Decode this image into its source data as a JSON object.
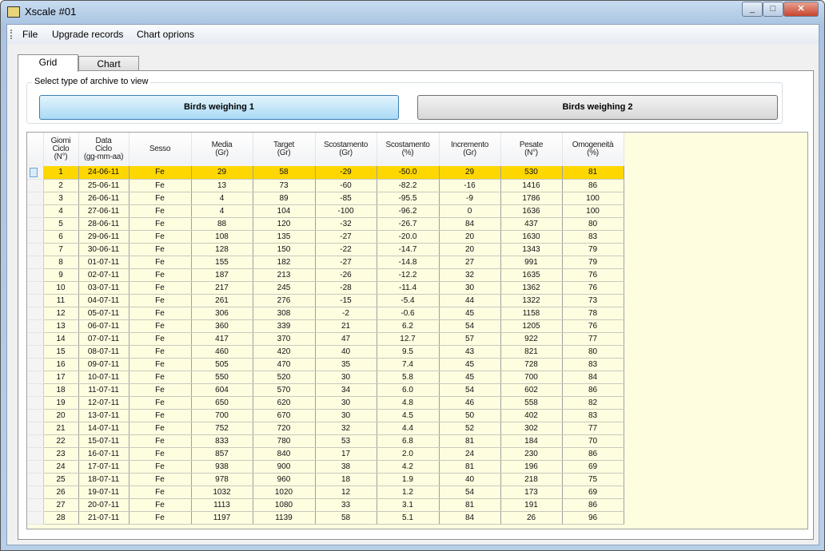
{
  "window": {
    "title": "Xscale #01",
    "controls": [
      "_",
      "□",
      "✕"
    ]
  },
  "menu": [
    "File",
    "Upgrade records",
    "Chart oprions"
  ],
  "tabs": [
    "Grid",
    "Chart"
  ],
  "archive": {
    "label": "Select type of archive to view",
    "buttons": [
      "Birds weighing 1",
      "Birds weighing 2"
    ]
  },
  "grid": {
    "headers": [
      "Giorni\nCiclo\n(N°)",
      "Data\nCiclo\n(gg-mm-aa)",
      "Sesso",
      "Media\n(Gr)",
      "Target\n(Gr)",
      "Scostamento\n(Gr)",
      "Scostamento\n(%)",
      "Incremento\n(Gr)",
      "Pesate\n(N°)",
      "Omogeneità\n(%)"
    ],
    "selected_row": 0,
    "rows": [
      [
        "1",
        "24-06-11",
        "Fe",
        "29",
        "58",
        "-29",
        "-50.0",
        "29",
        "530",
        "81"
      ],
      [
        "2",
        "25-06-11",
        "Fe",
        "13",
        "73",
        "-60",
        "-82.2",
        "-16",
        "1416",
        "86"
      ],
      [
        "3",
        "26-06-11",
        "Fe",
        "4",
        "89",
        "-85",
        "-95.5",
        "-9",
        "1786",
        "100"
      ],
      [
        "4",
        "27-06-11",
        "Fe",
        "4",
        "104",
        "-100",
        "-96.2",
        "0",
        "1636",
        "100"
      ],
      [
        "5",
        "28-06-11",
        "Fe",
        "88",
        "120",
        "-32",
        "-26.7",
        "84",
        "437",
        "80"
      ],
      [
        "6",
        "29-06-11",
        "Fe",
        "108",
        "135",
        "-27",
        "-20.0",
        "20",
        "1630",
        "83"
      ],
      [
        "7",
        "30-06-11",
        "Fe",
        "128",
        "150",
        "-22",
        "-14.7",
        "20",
        "1343",
        "79"
      ],
      [
        "8",
        "01-07-11",
        "Fe",
        "155",
        "182",
        "-27",
        "-14.8",
        "27",
        "991",
        "79"
      ],
      [
        "9",
        "02-07-11",
        "Fe",
        "187",
        "213",
        "-26",
        "-12.2",
        "32",
        "1635",
        "76"
      ],
      [
        "10",
        "03-07-11",
        "Fe",
        "217",
        "245",
        "-28",
        "-11.4",
        "30",
        "1362",
        "76"
      ],
      [
        "11",
        "04-07-11",
        "Fe",
        "261",
        "276",
        "-15",
        "-5.4",
        "44",
        "1322",
        "73"
      ],
      [
        "12",
        "05-07-11",
        "Fe",
        "306",
        "308",
        "-2",
        "-0.6",
        "45",
        "1158",
        "78"
      ],
      [
        "13",
        "06-07-11",
        "Fe",
        "360",
        "339",
        "21",
        "6.2",
        "54",
        "1205",
        "76"
      ],
      [
        "14",
        "07-07-11",
        "Fe",
        "417",
        "370",
        "47",
        "12.7",
        "57",
        "922",
        "77"
      ],
      [
        "15",
        "08-07-11",
        "Fe",
        "460",
        "420",
        "40",
        "9.5",
        "43",
        "821",
        "80"
      ],
      [
        "16",
        "09-07-11",
        "Fe",
        "505",
        "470",
        "35",
        "7.4",
        "45",
        "728",
        "83"
      ],
      [
        "17",
        "10-07-11",
        "Fe",
        "550",
        "520",
        "30",
        "5.8",
        "45",
        "700",
        "84"
      ],
      [
        "18",
        "11-07-11",
        "Fe",
        "604",
        "570",
        "34",
        "6.0",
        "54",
        "602",
        "86"
      ],
      [
        "19",
        "12-07-11",
        "Fe",
        "650",
        "620",
        "30",
        "4.8",
        "46",
        "558",
        "82"
      ],
      [
        "20",
        "13-07-11",
        "Fe",
        "700",
        "670",
        "30",
        "4.5",
        "50",
        "402",
        "83"
      ],
      [
        "21",
        "14-07-11",
        "Fe",
        "752",
        "720",
        "32",
        "4.4",
        "52",
        "302",
        "77"
      ],
      [
        "22",
        "15-07-11",
        "Fe",
        "833",
        "780",
        "53",
        "6.8",
        "81",
        "184",
        "70"
      ],
      [
        "23",
        "16-07-11",
        "Fe",
        "857",
        "840",
        "17",
        "2.0",
        "24",
        "230",
        "86"
      ],
      [
        "24",
        "17-07-11",
        "Fe",
        "938",
        "900",
        "38",
        "4.2",
        "81",
        "196",
        "69"
      ],
      [
        "25",
        "18-07-11",
        "Fe",
        "978",
        "960",
        "18",
        "1.9",
        "40",
        "218",
        "75"
      ],
      [
        "26",
        "19-07-11",
        "Fe",
        "1032",
        "1020",
        "12",
        "1.2",
        "54",
        "173",
        "69"
      ],
      [
        "27",
        "20-07-11",
        "Fe",
        "1113",
        "1080",
        "33",
        "3.1",
        "81",
        "191",
        "86"
      ],
      [
        "28",
        "21-07-11",
        "Fe",
        "1197",
        "1139",
        "58",
        "5.1",
        "84",
        "26",
        "96"
      ]
    ]
  },
  "colors": {
    "selected_row": "#ffd700",
    "grid_bg": "#fefde0",
    "active_button": "#a9daf6"
  }
}
